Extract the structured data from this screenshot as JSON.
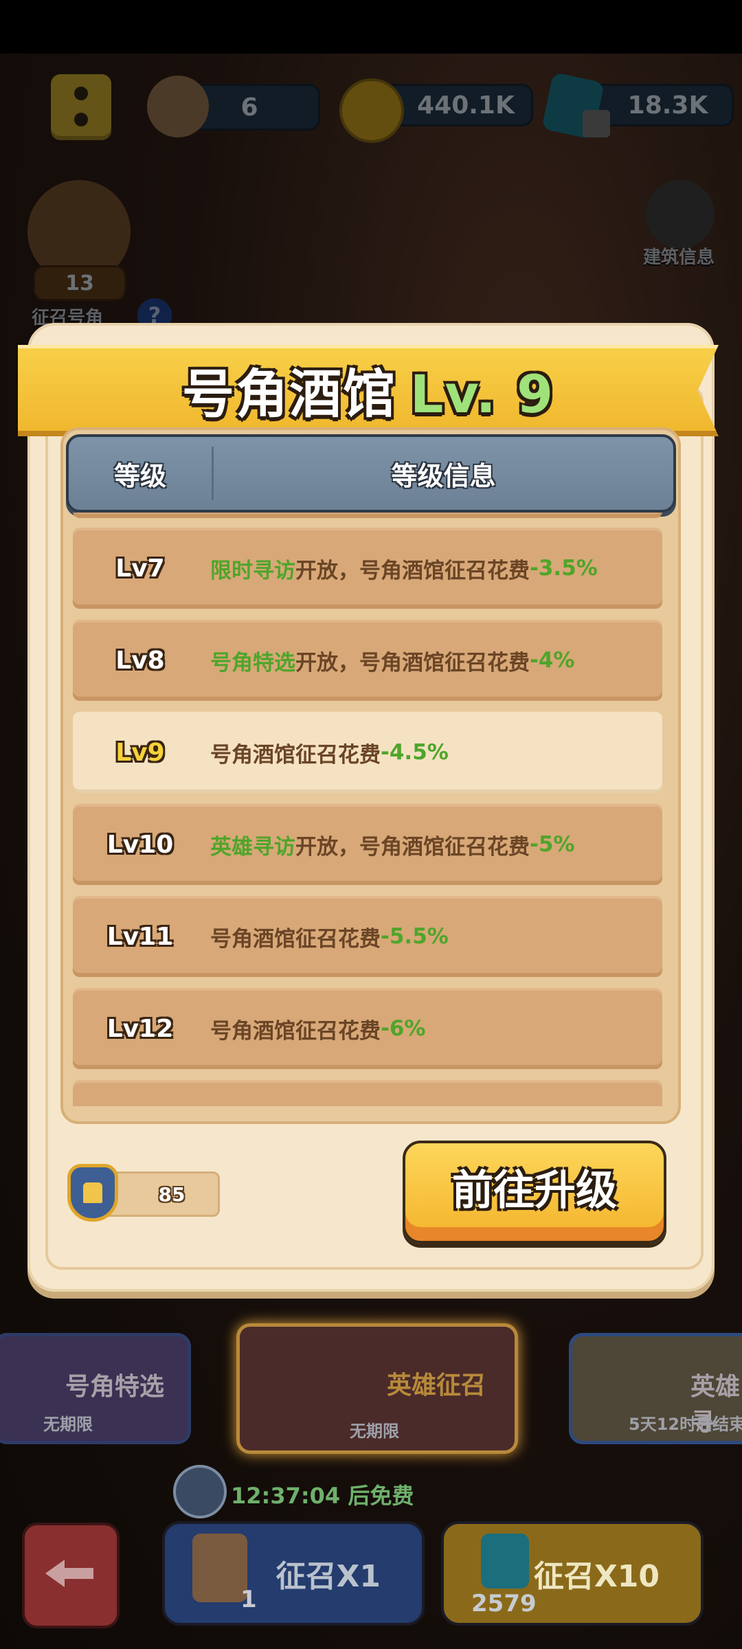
{
  "hud": {
    "scroll_count": "6",
    "gold": "440.1K",
    "gems": "18.3K"
  },
  "side": {
    "horn_count": "13",
    "horn_label": "征召号角",
    "help": "?",
    "building_info": "建筑信息"
  },
  "modal": {
    "title": "号角酒馆",
    "level": "Lv. 9",
    "table_headers": [
      "等级",
      "等级信息"
    ],
    "rows": [
      {
        "level": "Lv7",
        "highlight": "限时寻访",
        "text": "开放，号角酒馆征召花费",
        "value": "-3.5%"
      },
      {
        "level": "Lv8",
        "highlight": "号角特选",
        "text": "开放，号角酒馆征召花费",
        "value": "-4%"
      },
      {
        "level": "Lv9",
        "highlight": "",
        "text": "号角酒馆征召花费",
        "value": "-4.5%"
      },
      {
        "level": "Lv10",
        "highlight": "英雄寻访",
        "text": "开放，号角酒馆征召花费",
        "value": "-5%"
      },
      {
        "level": "Lv11",
        "highlight": "",
        "text": "号角酒馆征召花费",
        "value": "-5.5%"
      },
      {
        "level": "Lv12",
        "highlight": "",
        "text": "号角酒馆征召花费",
        "value": "-6%"
      }
    ],
    "token_count": "85",
    "upgrade_label": "前往升级"
  },
  "bottom": {
    "card_left_title": "号角特选",
    "card_left_sub": "无期限",
    "card_center_title": "英雄征召",
    "card_center_sub": "无期限",
    "card_right_title": "英雄寻",
    "card_right_sub": "5天12时后结束",
    "timer": "12:37:04 后免费",
    "summon1_label": "征召X1",
    "summon1_count": "1",
    "summon10_label": "征召X10",
    "summon10_count": "2579"
  },
  "colors": {
    "accent_yellow": "#f4b32b",
    "accent_green": "#4fa52a",
    "row_bg": "#d8a878",
    "row_active_bg": "#f5e2c3"
  }
}
